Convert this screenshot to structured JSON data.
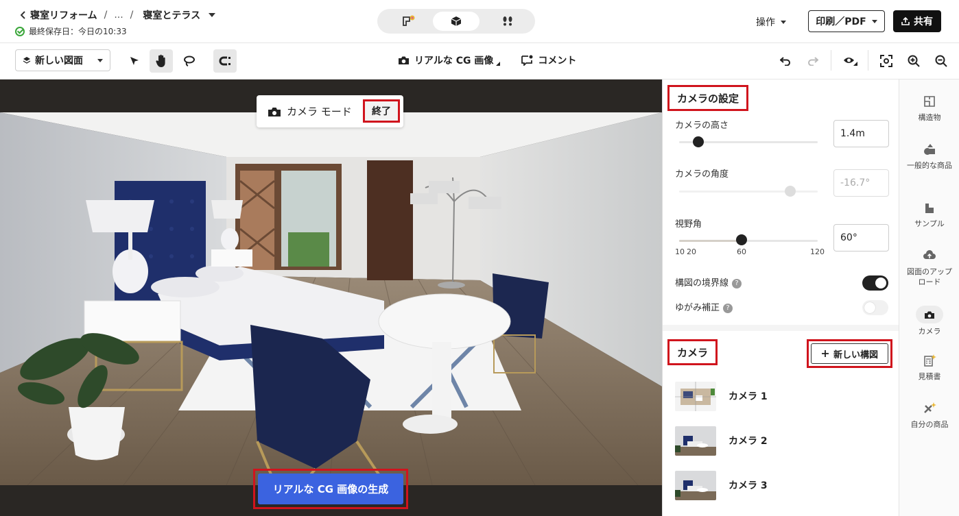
{
  "header": {
    "breadcrumb": {
      "back_label": "寝室リフォーム",
      "ellipsis": "...",
      "sep1": "/",
      "sep2": "/",
      "current": "寝室とテラス"
    },
    "saved_status": "最終保存日：今日の10:33",
    "operations_label": "操作",
    "print_label": "印刷／PDF",
    "share_label": "共有"
  },
  "toolbar": {
    "new_plan_label": "新しい図面",
    "realistic_cg_label": "リアルな CG 画像",
    "comment_label": "コメント"
  },
  "viewport": {
    "camera_mode_label": "カメラ モード",
    "end_label": "終了",
    "generate_label": "リアルな CG 画像の生成"
  },
  "camera_settings": {
    "title": "カメラの設定",
    "height_label": "カメラの高さ",
    "height_value": "1.4m",
    "angle_label": "カメラの角度",
    "angle_value": "-16.7°",
    "fov_label": "視野角",
    "fov_value": "60°",
    "fov_ticks": [
      "10",
      "20",
      "60",
      "120"
    ],
    "composition_lines_label": "構図の境界線",
    "composition_lines_on": true,
    "distortion_label": "ゆがみ補正",
    "distortion_on": false,
    "help_glyph": "?"
  },
  "cameras": {
    "title": "カメラ",
    "new_composition_label": "新しい構図",
    "items": [
      {
        "label": "カメラ 1"
      },
      {
        "label": "カメラ 2"
      },
      {
        "label": "カメラ 3"
      }
    ]
  },
  "rail": {
    "items": [
      {
        "label": "構造物",
        "icon": "structure-icon"
      },
      {
        "label": "一般的な商品",
        "icon": "products-icon"
      },
      {
        "label": "サンプル",
        "icon": "sample-icon"
      },
      {
        "label": "図面のアップロード",
        "icon": "upload-icon"
      },
      {
        "label": "カメラ",
        "icon": "camera-icon"
      },
      {
        "label": "見積書",
        "icon": "estimate-icon"
      },
      {
        "label": "自分の商品",
        "icon": "my-products-icon"
      }
    ]
  },
  "colors": {
    "accent": "#3b63e0",
    "highlight": "#d0141d",
    "success": "#3aa63a"
  }
}
